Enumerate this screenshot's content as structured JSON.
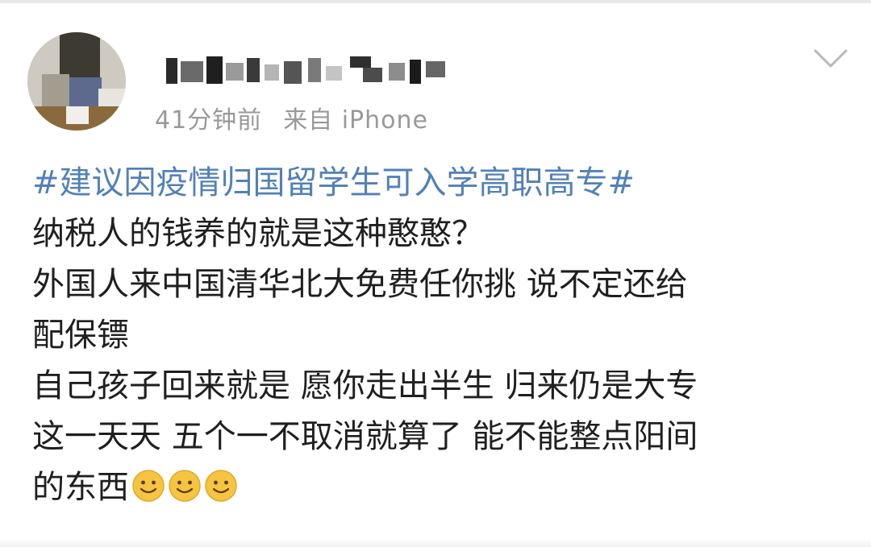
{
  "post": {
    "meta": {
      "time": "41分钟前",
      "source": "来自 iPhone"
    },
    "hashtag": "#建议因疫情归国留学生可入学高职高专#",
    "lines": [
      "纳税人的钱养的就是这种憨憨？",
      "外国人来中国清华北大免费任你挑 说不定还给",
      "配保镖",
      "自己孩子回来就是 愿你走出半生 归来仍是大专",
      "这一天天 五个一不取消就算了 能不能整点阳间",
      "的东西"
    ],
    "emoji_names": [
      "smile-emoji",
      "smile-emoji",
      "smile-emoji"
    ]
  },
  "colors": {
    "hashtag": "#5280b8",
    "meta": "#999999",
    "body_text": "#1f1f1f",
    "emoji_face": "#f5c542"
  }
}
